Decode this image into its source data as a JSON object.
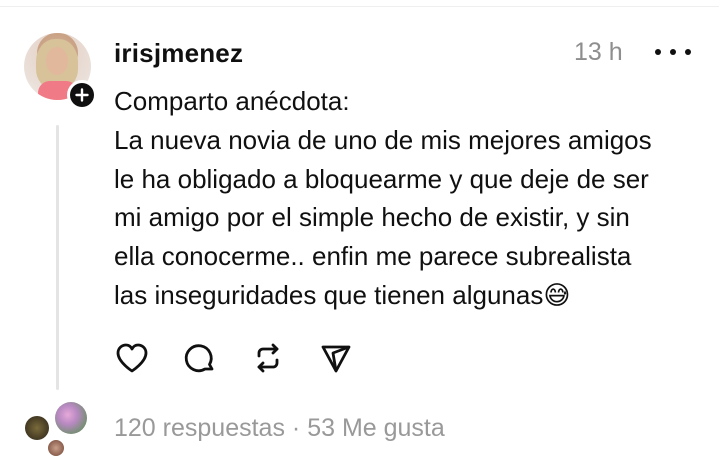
{
  "post": {
    "username": "irisjmenez",
    "time": "13 h",
    "text": "Comparto anécdota:\nLa nueva novia de uno de mis mejores amigos\nle ha obligado a  bloquearme y que deje de ser\nmi amigo por el simple hecho de existir, y sin\nella conocerme.. enfin me parece subrealista\nlas inseguridades que tienen algunas😅",
    "replies": "120 respuestas",
    "separator": "·",
    "likes": "53 Me gusta"
  },
  "icons": {
    "avatar": "profile-photo",
    "follow": "plus-icon",
    "more": "more-horizontal-icon",
    "like": "heart-icon",
    "reply": "comment-icon",
    "repost": "repost-icon",
    "share": "send-icon"
  },
  "colors": {
    "text": "#101010",
    "muted": "#8e8e8e",
    "thread_line": "#e4e4e4",
    "background": "#ffffff"
  }
}
